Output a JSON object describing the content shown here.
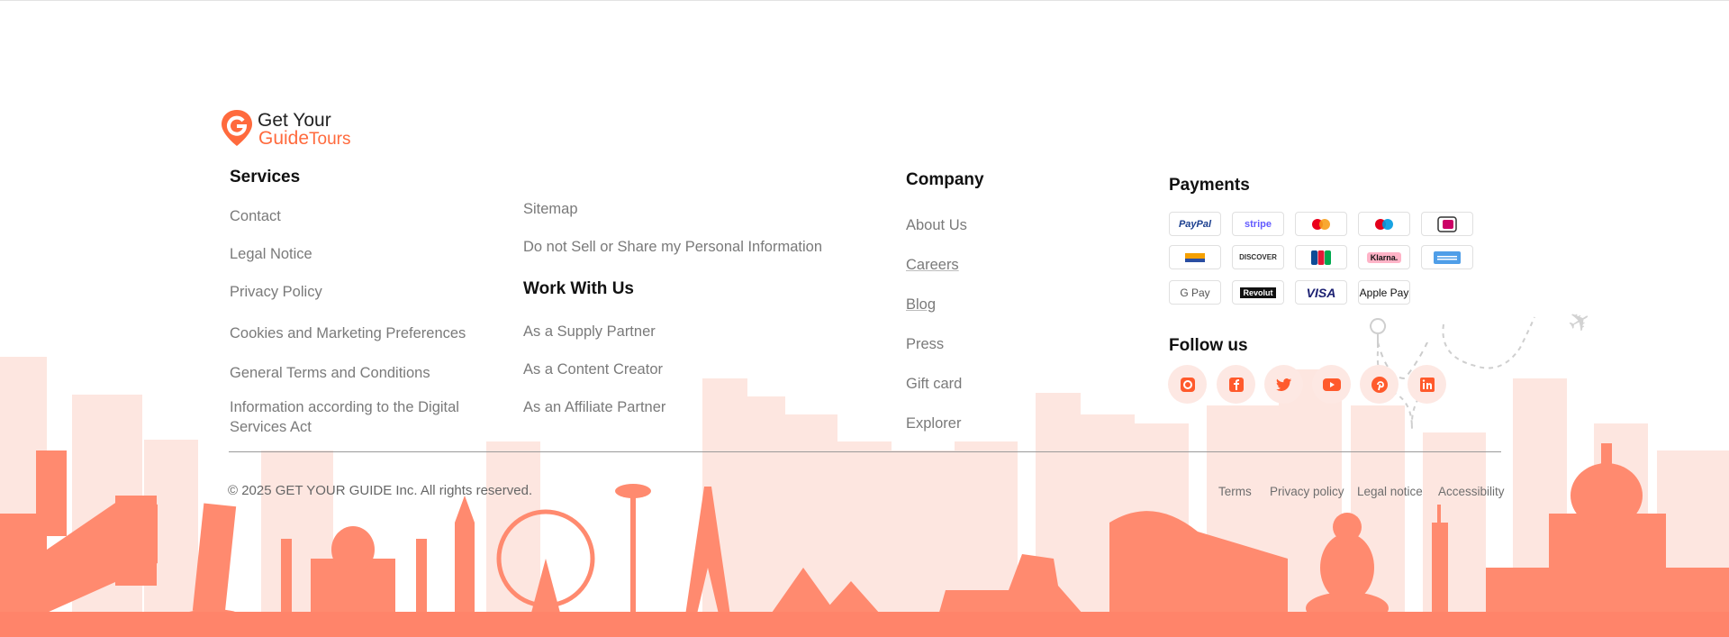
{
  "brand": {
    "line1": "Get Your",
    "line2_main": "Guide",
    "line2_sub": "Tours"
  },
  "services": {
    "heading": "Services",
    "links": [
      "Contact",
      "Legal Notice",
      "Privacy Policy",
      "Cookies and Marketing Preferences",
      "General Terms and Conditions",
      "Information according to the Digital Services Act"
    ]
  },
  "misc_links": [
    "Sitemap",
    "Do not Sell or Share my Personal Information"
  ],
  "work": {
    "heading": "Work With Us",
    "links": [
      "As a Supply Partner",
      "As a Content Creator",
      "As an Affiliate Partner"
    ]
  },
  "company": {
    "heading": "Company",
    "links": [
      "About Us",
      "Careers",
      "Blog",
      "Press",
      "Gift card",
      "Explorer"
    ]
  },
  "payments": {
    "heading": "Payments",
    "methods": [
      "PayPal",
      "stripe",
      "Mastercard",
      "Maestro",
      "iDEAL",
      "Sofort",
      "DISCOVER",
      "JCB",
      "Klarna.",
      "American Express",
      "G Pay",
      "Revolut",
      "VISA",
      "Apple Pay"
    ]
  },
  "follow": {
    "heading": "Follow us",
    "networks": [
      "instagram-icon",
      "facebook-icon",
      "twitter-icon",
      "youtube-icon",
      "pinterest-icon",
      "linkedin-icon"
    ]
  },
  "copyright": "© 2025 GET YOUR GUIDE Inc. All rights reserved.",
  "legal_links": [
    "Terms",
    "Privacy policy",
    "Legal notice",
    "Accessibility"
  ],
  "colors": {
    "accent": "#ff6a3d",
    "skyline_light": "#fde3dc",
    "skyline_dark": "#ff8a6f",
    "ground": "#ff846a"
  }
}
